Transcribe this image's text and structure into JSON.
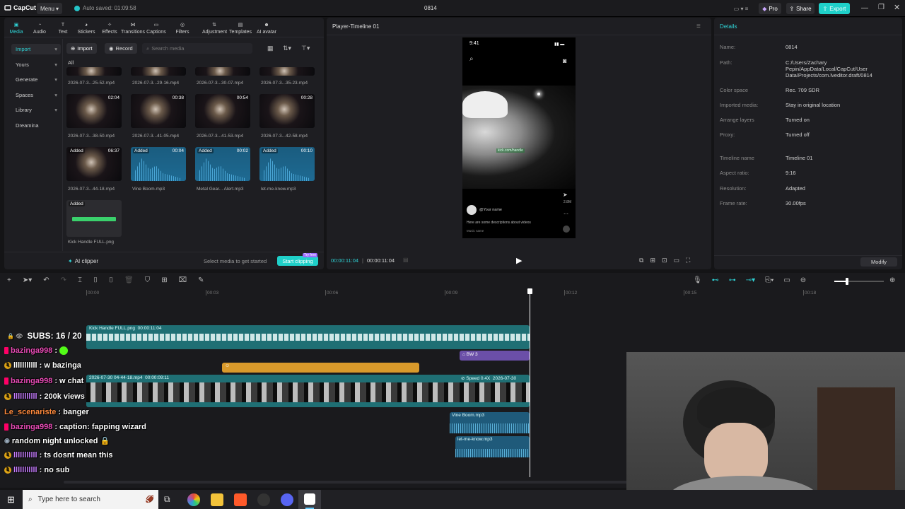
{
  "titlebar": {
    "app_name": "CapCut",
    "menu_label": "Menu",
    "autosave": "Auto saved: 01:09:58",
    "project_name": "0814",
    "pro_label": "Pro",
    "share_label": "Share",
    "export_label": "Export"
  },
  "toolbar": {
    "items": [
      "Media",
      "Audio",
      "Text",
      "Stickers",
      "Effects",
      "Transitions",
      "Captions",
      "Filters",
      "Adjustment",
      "Templates",
      "AI avatar"
    ]
  },
  "sidebar": {
    "items": [
      "Import",
      "Yours",
      "Generate",
      "Spaces",
      "Library",
      "Dreamina"
    ]
  },
  "media": {
    "import_label": "Import",
    "record_label": "Record",
    "search_placeholder": "Search media",
    "all_label": "All",
    "row1": [
      "2026-07-3...25-52.mp4",
      "2026-07-3...29-16.mp4",
      "2026-07-3...30-07.mp4",
      "2026-07-3...35-23.mp4"
    ],
    "row2": [
      {
        "name": "2026-07-3...38-50.mp4",
        "dur": "02:04"
      },
      {
        "name": "2026-07-3...41-05.mp4",
        "dur": "00:38"
      },
      {
        "name": "2026-07-3...41-53.mp4",
        "dur": "00:54"
      },
      {
        "name": "2026-07-3...42-58.mp4",
        "dur": "00:28"
      }
    ],
    "row3": [
      {
        "name": "2026-07-3...44-18.mp4",
        "dur": "06:37"
      },
      {
        "name": "Vine Boom.mp3",
        "dur": "00:04"
      },
      {
        "name": "Metal Gear... Alert.mp3",
        "dur": "00:02"
      },
      {
        "name": "let-me-know.mp3",
        "dur": "00:10"
      }
    ],
    "row4": [
      {
        "name": "Kick Handle FULL.png"
      }
    ],
    "added_label": "Added",
    "ai_clipper": "AI clipper",
    "select_hint": "Select media to get started",
    "start_clipping": "Start clipping",
    "try_free": "Try free"
  },
  "player": {
    "title": "Player-Timeline 01",
    "current_time": "00:00:11:04",
    "total_time": "00:00:11:04",
    "phone_time": "9:41",
    "your_name": "@Your name",
    "description": "Here are some descriptions about videos",
    "music_name": "Music name",
    "likes": "2.8M"
  },
  "details": {
    "title": "Details",
    "rows": [
      {
        "label": "Name:",
        "value": "0814"
      },
      {
        "label": "Path:",
        "value": "C:/Users/Zachary Pepin/AppData/Local/CapCut/User Data/Projects/com.lveditor.draft/0814"
      },
      {
        "label": "Color space",
        "value": "Rec. 709 SDR"
      },
      {
        "label": "Imported media:",
        "value": "Stay in original location"
      },
      {
        "label": "Arrange layers",
        "value": "Turned on"
      },
      {
        "label": "Proxy:",
        "value": "Turned off"
      },
      {
        "label": "Timeline name",
        "value": "Timeline 01"
      },
      {
        "label": "Aspect ratio:",
        "value": "9:16"
      },
      {
        "label": "Resolution:",
        "value": "Adapted"
      },
      {
        "label": "Frame rate:",
        "value": "30.00fps"
      }
    ],
    "modify_label": "Modify"
  },
  "timeline": {
    "ruler": [
      "00:00",
      "00:03",
      "00:06",
      "00:09",
      "00:12",
      "00:15",
      "00:18"
    ],
    "clip_kick": "Kick Handle FULL.png",
    "clip_kick_dur": "00:00:11:04",
    "clip_bw": "BW 3",
    "clip_main": "2026-07-30 04-44-18.mp4",
    "clip_main_dur": "00:00:09:11",
    "clip_speed": "Speed 0.4X",
    "clip_main2": "2026-07-30",
    "clip_vine": "Vine Boom.mp3",
    "clip_letme": "let-me-know.mp3"
  },
  "overlay": {
    "subs": "SUBS: 16 / 20",
    "chat": [
      {
        "user": "bazinga998",
        "msg": ":",
        "color": "#e94bb6",
        "badge": "sub"
      },
      {
        "user": "lllllllllll",
        "msg": ": w bazinga",
        "color": "#ffffff",
        "badge": "gold"
      },
      {
        "user": "bazinga998",
        "msg": ": w chat",
        "color": "#e94bb6",
        "badge": "sub"
      },
      {
        "user": "lllllllllll",
        "msg": ": 200k views",
        "color": "#c77dff",
        "badge": "gold"
      },
      {
        "user": "Le_scenariste",
        "msg": ": banger",
        "color": "#ff8a3d",
        "badge": "none"
      },
      {
        "user": "bazinga998",
        "msg": ": caption: fapping wizard",
        "color": "#e94bb6",
        "badge": "sub"
      },
      {
        "user": "",
        "msg": "random night unlocked 🔒",
        "color": "#ffffff",
        "badge": "bot"
      },
      {
        "user": "lllllllllll",
        "msg": ": ts dosnt mean this",
        "color": "#c77dff",
        "badge": "gold"
      },
      {
        "user": "lllllllllll",
        "msg": ": no sub",
        "color": "#c77dff",
        "badge": "gold"
      }
    ]
  },
  "taskbar": {
    "search_placeholder": "Type here to search"
  },
  "colors": {
    "accent": "#2fd3d6",
    "export": "#1fd0c9",
    "gold": "#e0a516",
    "video_track": "#1f6f74",
    "audio_track": "#2a6c8f",
    "effect_track": "#6b4fa8",
    "sticker_track": "#d99a2b"
  }
}
